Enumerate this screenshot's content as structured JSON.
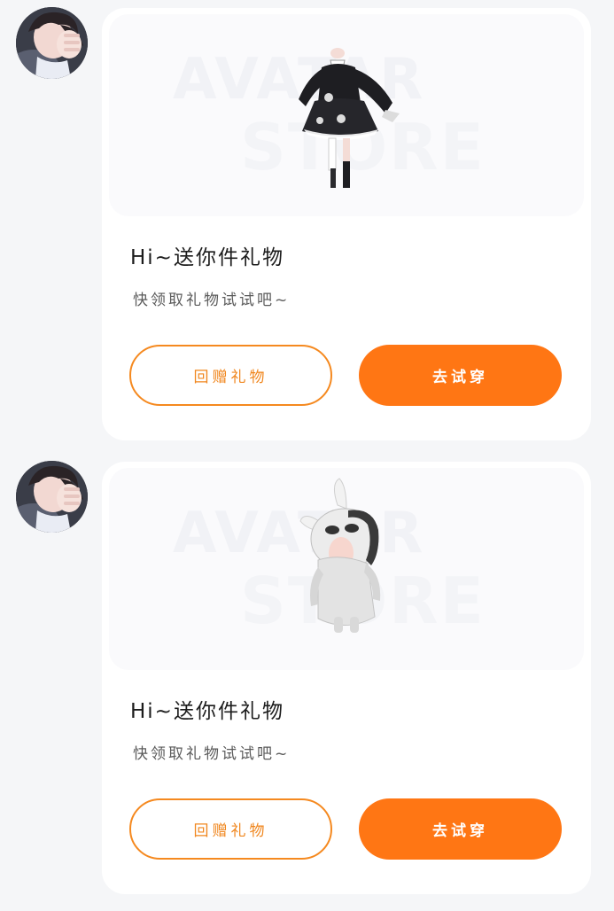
{
  "messages": [
    {
      "avatar_icon": "user-avatar",
      "banner_watermark": [
        "AVATAR",
        "STORE"
      ],
      "item_icon": "black-dress-outfit",
      "title": "Hi~送你件礼物",
      "subtitle": "快领取礼物试试吧~",
      "return_gift_label": "回赠礼物",
      "try_on_label": "去试穿"
    },
    {
      "avatar_icon": "user-avatar",
      "banner_watermark": [
        "AVATAR",
        "STORE"
      ],
      "item_icon": "bunny-hood-outfit",
      "title": "Hi~送你件礼物",
      "subtitle": "快领取礼物试试吧~",
      "return_gift_label": "回赠礼物",
      "try_on_label": "去试穿"
    }
  ],
  "colors": {
    "accent": "#ff7614",
    "accent_outline": "#f5891f",
    "page_bg": "#f5f6f8",
    "card_bg": "#ffffff"
  }
}
